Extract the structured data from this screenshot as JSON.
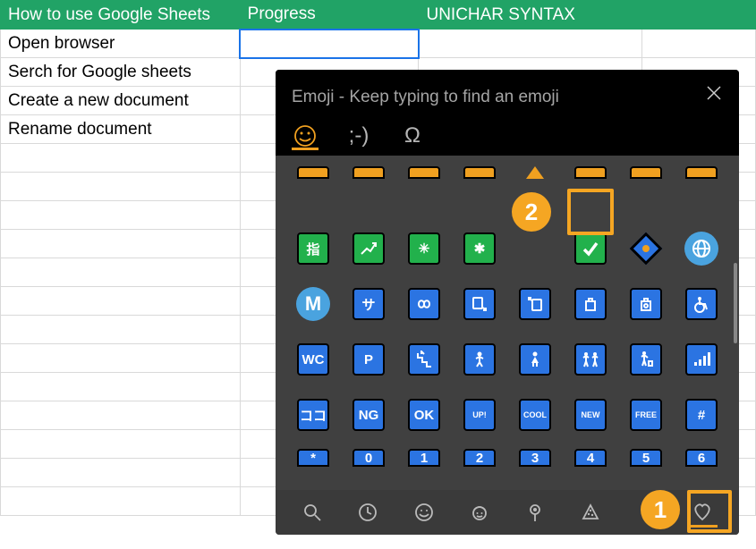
{
  "sheet": {
    "headers": [
      "How to use Google Sheets",
      "Progress",
      "UNICHAR SYNTAX",
      ""
    ],
    "rows": [
      [
        "Open browser",
        "",
        "",
        ""
      ],
      [
        "Serch for Google sheets",
        "",
        "",
        ""
      ],
      [
        "Create a new document",
        "",
        "",
        ""
      ],
      [
        "Rename document",
        "",
        "",
        ""
      ],
      [
        "",
        "",
        "",
        ""
      ],
      [
        "",
        "",
        "",
        ""
      ],
      [
        "",
        "",
        "",
        ""
      ],
      [
        "",
        "",
        "",
        ""
      ],
      [
        "",
        "",
        "",
        ""
      ],
      [
        "",
        "",
        "",
        ""
      ],
      [
        "",
        "",
        "",
        ""
      ],
      [
        "",
        "",
        "",
        ""
      ],
      [
        "",
        "",
        "",
        ""
      ],
      [
        "",
        "",
        "",
        ""
      ],
      [
        "",
        "",
        "",
        ""
      ],
      [
        "",
        "",
        "",
        ""
      ],
      [
        "",
        "",
        "",
        ""
      ]
    ],
    "active_cell": {
      "row": 0,
      "col": 1
    }
  },
  "emoji_picker": {
    "title": "Emoji - Keep typing to find an emoji",
    "tabs": {
      "emoji": "☺",
      "kaomoji": ";-)",
      "symbols": "Ω"
    },
    "rows": [
      [
        {
          "kind": "square",
          "bg": "green",
          "label": "指"
        },
        {
          "kind": "square",
          "bg": "green",
          "glyph": "chart-up"
        },
        {
          "kind": "square",
          "bg": "green",
          "label": "✳"
        },
        {
          "kind": "square",
          "bg": "green",
          "label": "✱"
        },
        {
          "kind": "annot",
          "num": "2"
        },
        {
          "kind": "square",
          "bg": "green",
          "glyph": "check",
          "highlight": true
        },
        {
          "kind": "diamond"
        },
        {
          "kind": "circle",
          "bg": "lightblue",
          "glyph": "globe"
        }
      ],
      [
        {
          "kind": "circle",
          "bg": "lightblue",
          "label": "M"
        },
        {
          "kind": "square",
          "bg": "blue",
          "label": "サ"
        },
        {
          "kind": "square",
          "bg": "blue",
          "glyph": "infinity"
        },
        {
          "kind": "square",
          "bg": "blue",
          "glyph": "phone-down"
        },
        {
          "kind": "square",
          "bg": "blue",
          "glyph": "phone-up"
        },
        {
          "kind": "square",
          "bg": "blue",
          "glyph": "baggage"
        },
        {
          "kind": "square",
          "bg": "blue",
          "glyph": "left-luggage"
        },
        {
          "kind": "square",
          "bg": "blue",
          "glyph": "wheelchair"
        }
      ],
      [
        {
          "kind": "square",
          "bg": "blue",
          "label": "WC"
        },
        {
          "kind": "square",
          "bg": "blue",
          "label": "P"
        },
        {
          "kind": "square",
          "bg": "blue",
          "glyph": "stairs"
        },
        {
          "kind": "square",
          "bg": "blue",
          "glyph": "man"
        },
        {
          "kind": "square",
          "bg": "blue",
          "glyph": "woman"
        },
        {
          "kind": "square",
          "bg": "blue",
          "glyph": "family"
        },
        {
          "kind": "square",
          "bg": "blue",
          "glyph": "litter"
        },
        {
          "kind": "square",
          "bg": "blue",
          "glyph": "signal"
        }
      ],
      [
        {
          "kind": "square",
          "bg": "blue",
          "label": "ココ"
        },
        {
          "kind": "square",
          "bg": "blue",
          "label": "NG"
        },
        {
          "kind": "square",
          "bg": "blue",
          "label": "OK"
        },
        {
          "kind": "square",
          "bg": "blue",
          "label": "UP!",
          "small": true
        },
        {
          "kind": "square",
          "bg": "blue",
          "label": "COOL",
          "small": true
        },
        {
          "kind": "square",
          "bg": "blue",
          "label": "NEW",
          "small": true
        },
        {
          "kind": "square",
          "bg": "blue",
          "label": "FREE",
          "small": true
        },
        {
          "kind": "square",
          "bg": "blue",
          "label": "#"
        }
      ],
      [
        {
          "kind": "square",
          "bg": "blue",
          "label": "*"
        },
        {
          "kind": "square",
          "bg": "blue",
          "label": "0"
        },
        {
          "kind": "square",
          "bg": "blue",
          "label": "1"
        },
        {
          "kind": "square",
          "bg": "blue",
          "label": "2"
        },
        {
          "kind": "square",
          "bg": "blue",
          "label": "3"
        },
        {
          "kind": "square",
          "bg": "blue",
          "label": "4"
        },
        {
          "kind": "square",
          "bg": "blue",
          "label": "5"
        },
        {
          "kind": "square",
          "bg": "blue",
          "label": "6"
        }
      ]
    ],
    "footer": {
      "items": [
        "search",
        "clock",
        "grin",
        "girl",
        "pin",
        "pizza",
        "1",
        "heart"
      ]
    },
    "annotations": {
      "annot1": "1",
      "annot2": "2"
    }
  }
}
